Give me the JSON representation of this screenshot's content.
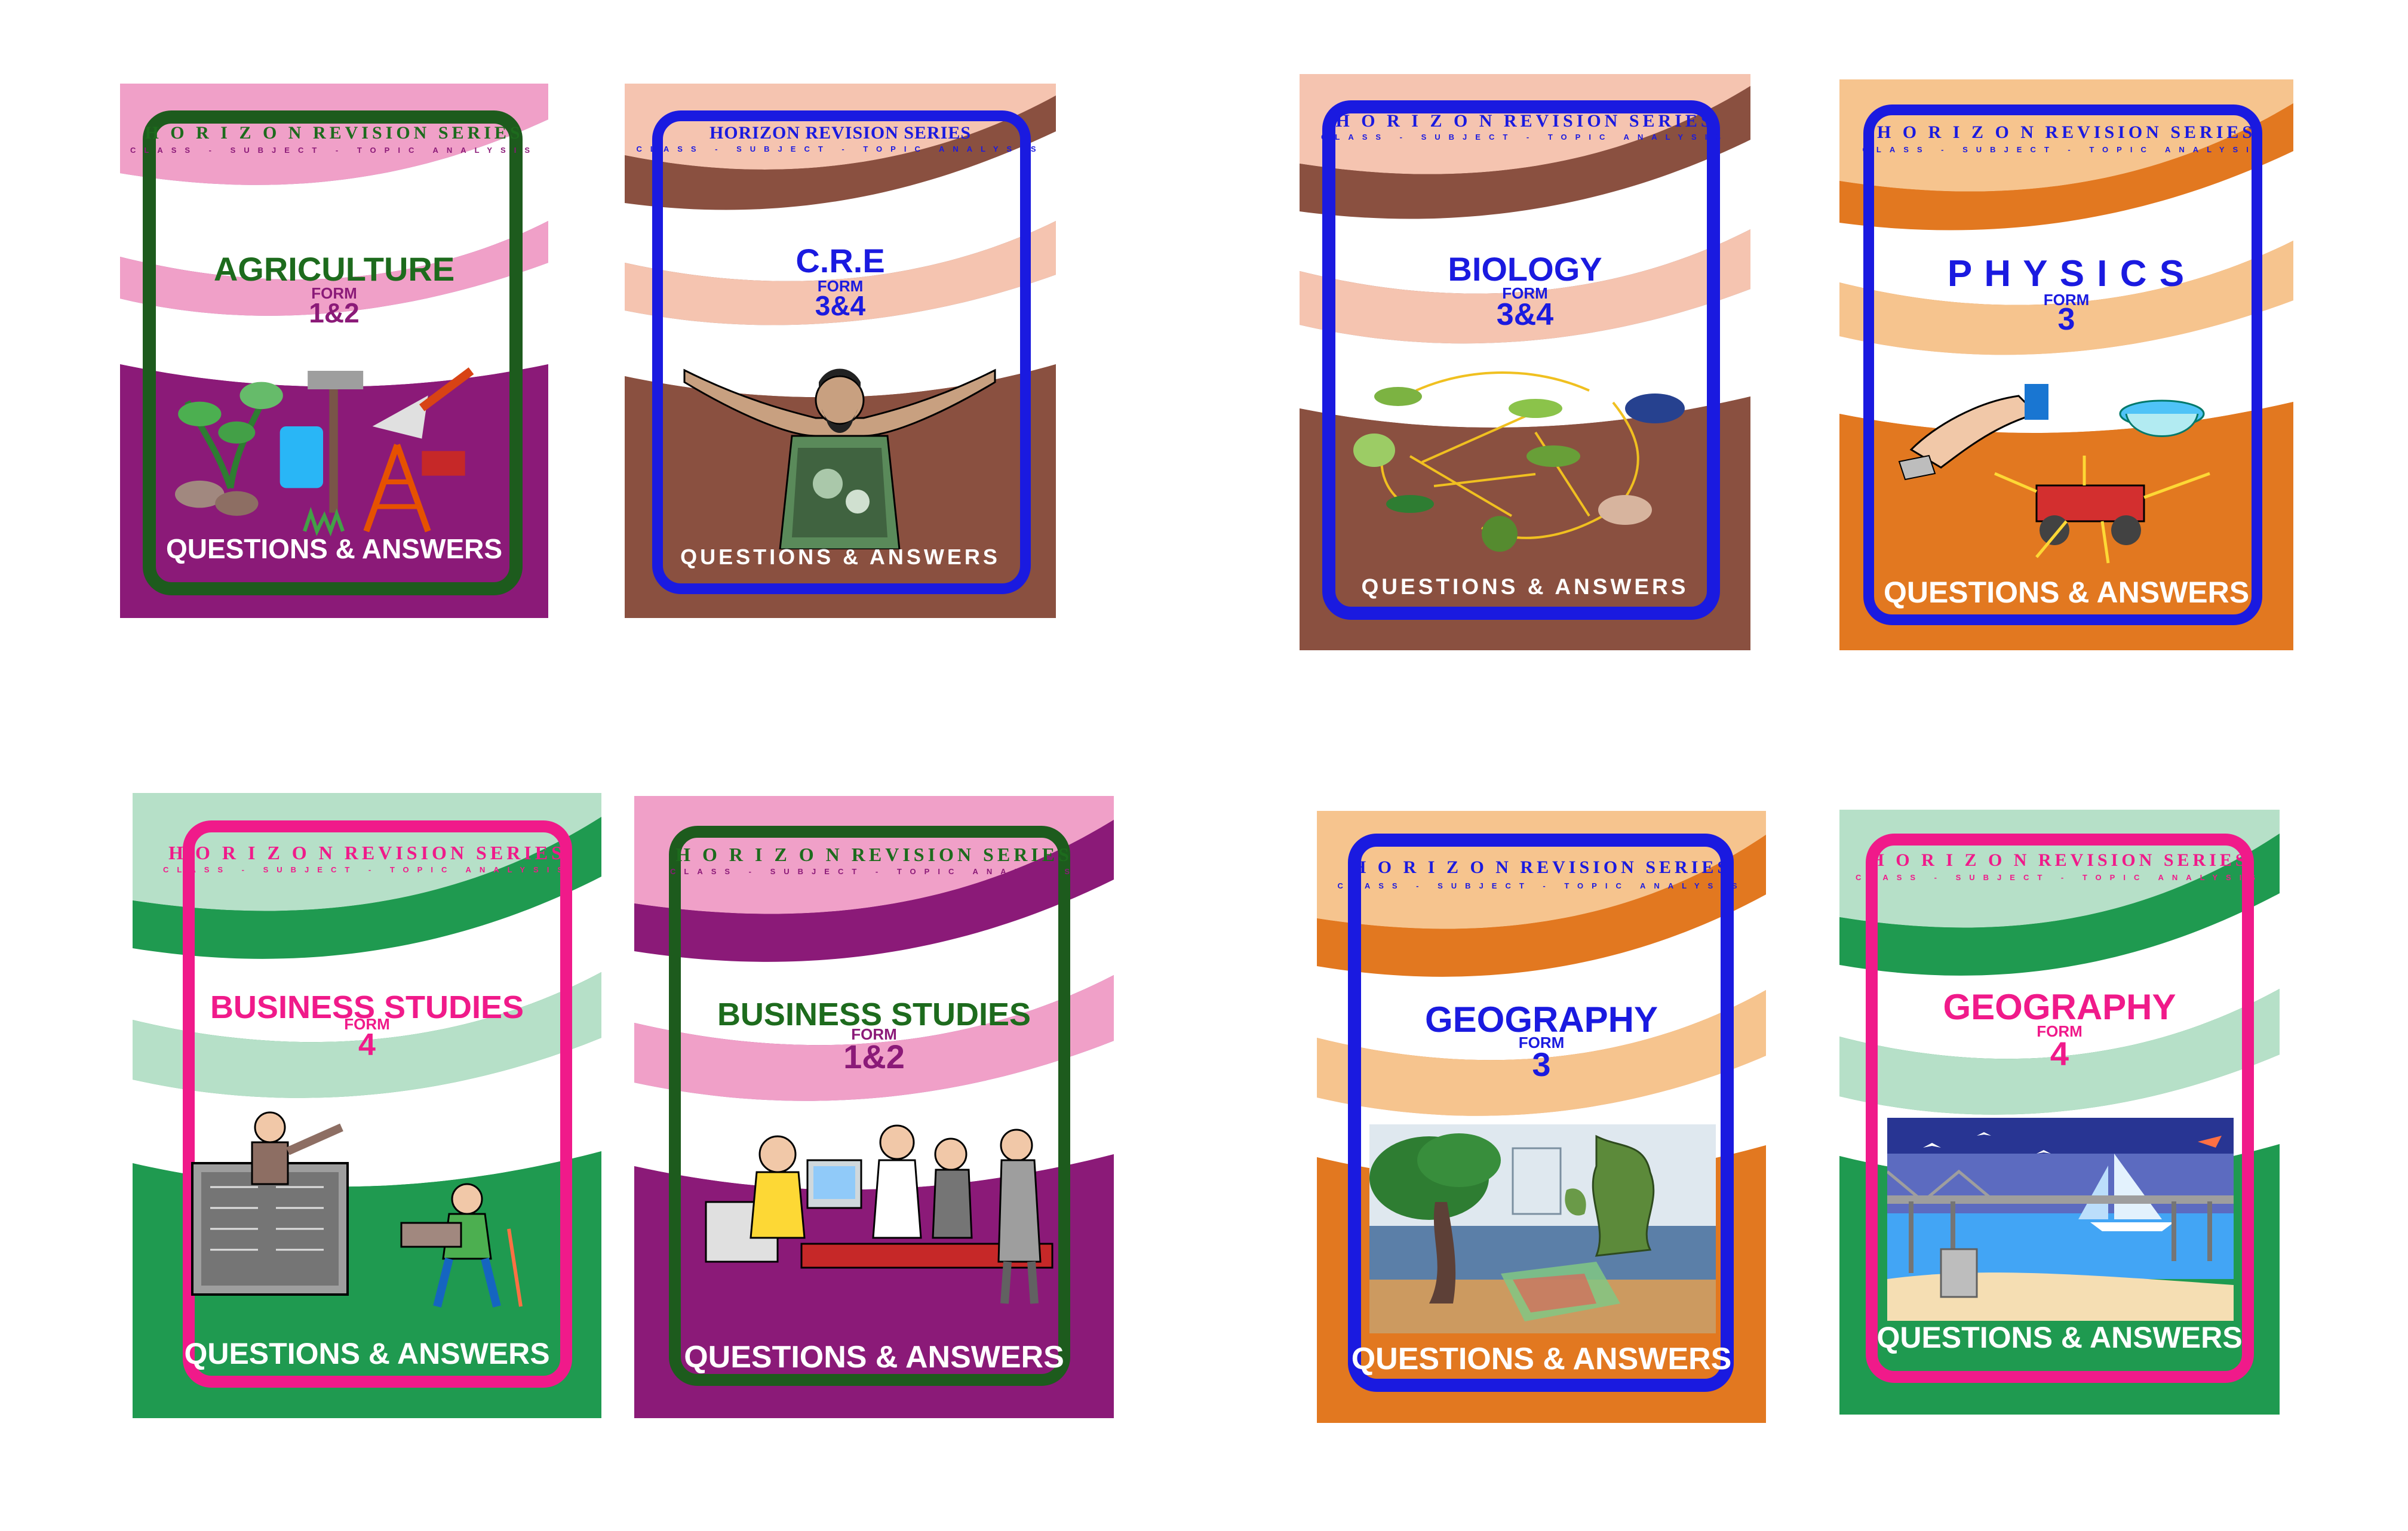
{
  "colors": {
    "purple": "#8b1a78",
    "pink": "#f0a0c8",
    "brown": "#8a5040",
    "peach": "#f5c4b0",
    "orange": "#e27820",
    "light_orange": "#f6c48e",
    "green": "#1f9a50",
    "mint": "#b6e0c8",
    "dark_green_frame": "#1d5b1d",
    "blue_frame": "#1a1ae0",
    "magenta_frame": "#f01a8a"
  },
  "books": [
    {
      "series": "H O R I Z O N  REVISION SERIES",
      "tagline": "CLASS - SUBJECT - TOPIC  ANALYSIS",
      "subject": "AGRICULTURE",
      "form_label": "FORM",
      "level": "1&2",
      "footer": "QUESTIONS & ANSWERS",
      "illustration": "farm-tools-icon"
    },
    {
      "series": "HORIZON REVISION SERIES",
      "tagline": "CLASS - SUBJECT - TOPIC  ANALYSIS",
      "subject": "C.R.E",
      "form_label": "FORM",
      "level": "3&4",
      "footer": "QUESTIONS & ANSWERS",
      "illustration": "preacher-icon"
    },
    {
      "series": "H O R I Z O N  REVISION SERIES",
      "tagline": "CLASS - SUBJECT - TOPIC  ANALYSIS",
      "subject": "BIOLOGY",
      "form_label": "FORM",
      "level": "3&4",
      "footer": "QUESTIONS & ANSWERS",
      "illustration": "food-web-icon"
    },
    {
      "series": "H O R I Z O N  REVISION SERIES",
      "tagline": "CLASS - SUBJECT - TOPIC  ANALYSIS",
      "subject": "P H Y S I C S",
      "form_label": "FORM",
      "level": "3",
      "footer": "QUESTIONS & ANSWERS",
      "illustration": "forces-cart-icon"
    },
    {
      "series": "H O R I Z O N  REVISION SERIES",
      "tagline": "CLASS - SUBJECT - TOPIC  ANALYSIS",
      "subject": "BUSINESS  STUDIES",
      "form_label": "FORM",
      "level": "4",
      "footer": "QUESTIONS & ANSWERS",
      "illustration": "classroom-icon"
    },
    {
      "series": "H O R I Z O N  REVISION SERIES",
      "tagline": "CLASS - SUBJECT - TOPIC  ANALYSIS",
      "subject": "BUSINESS  STUDIES",
      "form_label": "FORM",
      "level": "1&2",
      "footer": "QUESTIONS & ANSWERS",
      "illustration": "office-workers-icon"
    },
    {
      "series": "H O R I Z O N  REVISION SERIES",
      "tagline": "CLASS - SUBJECT - TOPIC  ANALYSIS",
      "subject": "GEOGRAPHY",
      "form_label": "FORM",
      "level": "3",
      "footer": "QUESTIONS & ANSWERS",
      "illustration": "map-tree-icon"
    },
    {
      "series": "H O R I Z O N  REVISION SERIES",
      "tagline": "CLASS - SUBJECT - TOPIC  ANALYSIS",
      "subject": "GEOGRAPHY",
      "form_label": "FORM",
      "level": "4",
      "footer": "QUESTIONS & ANSWERS",
      "illustration": "bridge-sea-icon"
    }
  ]
}
